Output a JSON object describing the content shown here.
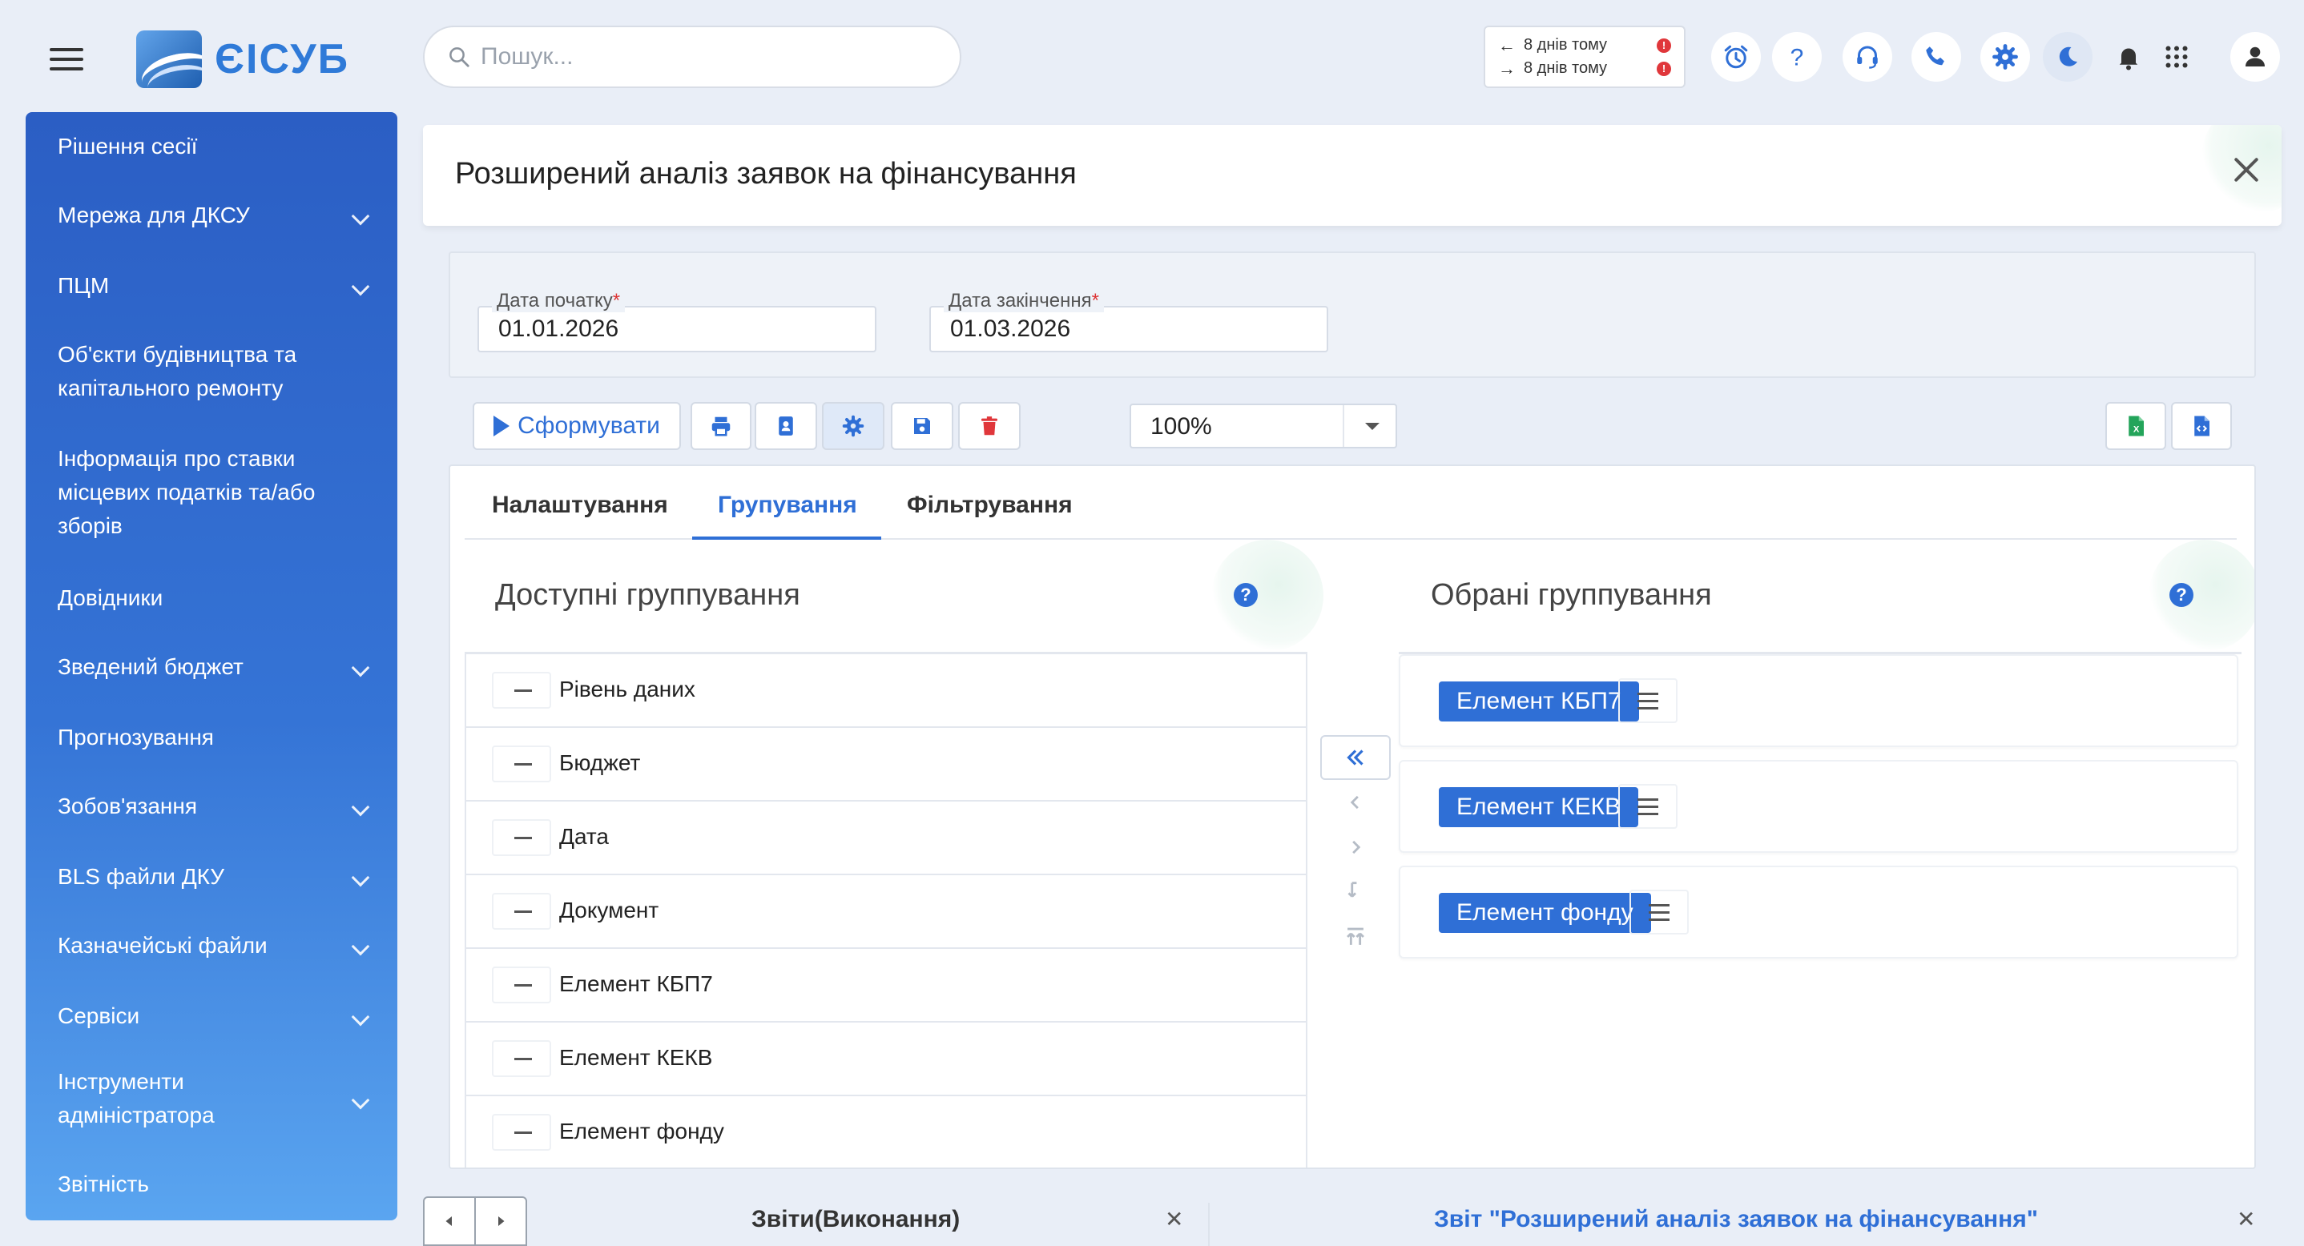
{
  "app": {
    "logo_text": "ЄІСУБ"
  },
  "search": {
    "placeholder": "Пошук..."
  },
  "recent": [
    {
      "direction": "back",
      "text": "8 днів тому",
      "badge": "!"
    },
    {
      "direction": "forward",
      "text": "8 днів тому",
      "badge": "!"
    }
  ],
  "top_icons": [
    "alarm-icon",
    "help-icon",
    "support-icon",
    "phone-icon",
    "settings-icon",
    "dark-mode-icon",
    "bell-icon",
    "apps-grid-icon",
    "user-icon"
  ],
  "sidebar": {
    "items": [
      {
        "label": "Рішення сесії",
        "expandable": false
      },
      {
        "label": "Мережа для ДКСУ",
        "expandable": true
      },
      {
        "label": "ПЦМ",
        "expandable": true
      },
      {
        "label": "Об'єкти будівництва та капітального ремонту",
        "expandable": false
      },
      {
        "label": "Інформація про ставки місцевих податків та/або зборів",
        "expandable": false
      },
      {
        "label": "Довідники",
        "expandable": false
      },
      {
        "label": "Зведений бюджет",
        "expandable": true
      },
      {
        "label": "Прогнозування",
        "expandable": false
      },
      {
        "label": "Зобов'язання",
        "expandable": true
      },
      {
        "label": "BLS файли ДКУ",
        "expandable": true
      },
      {
        "label": "Казначейські файли",
        "expandable": true
      },
      {
        "label": "Сервіси",
        "expandable": true
      },
      {
        "label": "Інструменти адміністратора",
        "expandable": true
      },
      {
        "label": "Звітність",
        "expandable": false
      }
    ]
  },
  "page": {
    "title": "Розширений аналіз заявок на фінансування"
  },
  "dates": {
    "start": {
      "label": "Дата початку",
      "required_mark": "*",
      "value": "01.01.2026"
    },
    "end": {
      "label": "Дата закінчення",
      "required_mark": "*",
      "value": "01.03.2026"
    }
  },
  "toolbar": {
    "generate_label": "Сформувати",
    "zoom_value": "100%",
    "buttons": [
      "print-icon",
      "user-card-icon",
      "settings-icon",
      "save-icon",
      "delete-icon",
      "excel-export-icon",
      "code-file-icon"
    ]
  },
  "tabs": [
    {
      "label": "Налаштування",
      "active": false
    },
    {
      "label": "Групування",
      "active": true
    },
    {
      "label": "Фільтрування",
      "active": false
    }
  ],
  "grouping": {
    "available_title": "Доступні группування",
    "selected_title": "Обрані группування",
    "help_glyph": "?",
    "available": [
      "Рівень даних",
      "Бюджет",
      "Дата",
      "Документ",
      "Елемент КБП7",
      "Елемент КЕКВ",
      "Елемент фонду"
    ],
    "selected": [
      "Елемент КБП7",
      "Елемент КЕКВ",
      "Елемент фонду"
    ],
    "move_controls": [
      "move-all-left-icon",
      "move-left-icon",
      "move-right-icon",
      "move-down-icon",
      "move-top-icon"
    ]
  },
  "bottom_tabs": [
    {
      "label": "Звіти(Виконання)",
      "active": false
    },
    {
      "label": "Звіт \"Розширений аналіз заявок на фінансування\"",
      "active": true
    }
  ],
  "colors": {
    "accent": "#2f6fd6",
    "sidebar_top": "#2b5ec4",
    "sidebar_bottom": "#5aa5f0",
    "badge": "#e0373b"
  }
}
